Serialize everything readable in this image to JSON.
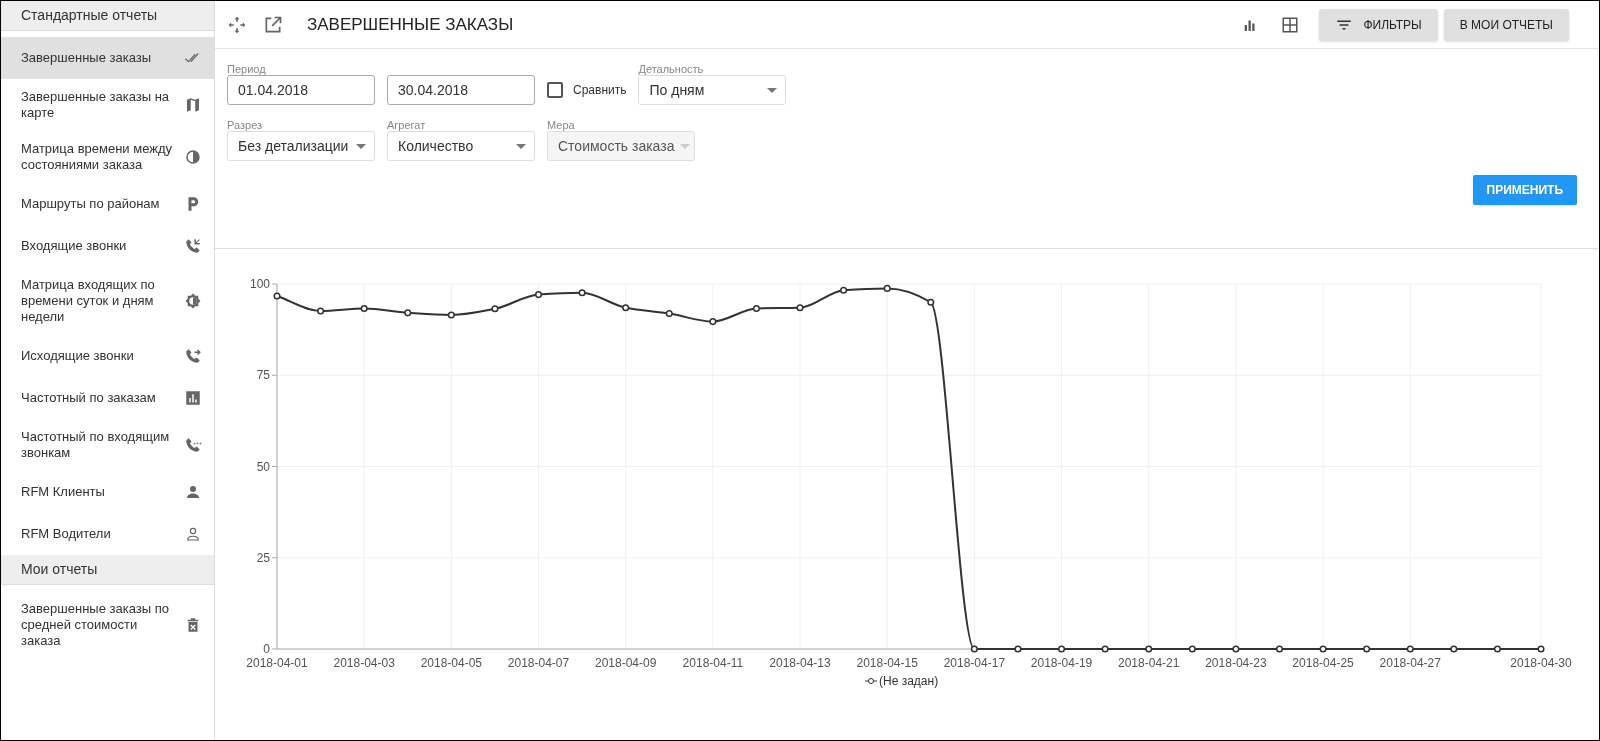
{
  "sidebar": {
    "sections": [
      {
        "title": "Стандартные отчеты",
        "items": [
          {
            "label": "Завершенные заказы",
            "selected": true
          },
          {
            "label": "Завершенные заказы на карте",
            "selected": false
          },
          {
            "label": "Матрица времени между состояниями заказа",
            "selected": false
          },
          {
            "label": "Маршруты по районам",
            "selected": false
          },
          {
            "label": "Входящие звонки",
            "selected": false
          },
          {
            "label": "Матрица входящих по времени суток и дням недели",
            "selected": false
          },
          {
            "label": "Исходящие звонки",
            "selected": false
          },
          {
            "label": "Частотный по заказам",
            "selected": false
          },
          {
            "label": "Частотный по входящим звонкам",
            "selected": false
          },
          {
            "label": "RFM Клиенты",
            "selected": false
          },
          {
            "label": "RFM Водители",
            "selected": false
          }
        ]
      },
      {
        "title": "Мои отчеты",
        "items": [
          {
            "label": "Завершенные заказы по средней стоимости заказа",
            "selected": false
          }
        ]
      }
    ]
  },
  "header": {
    "title": "ЗАВЕРШЕННЫЕ ЗАКАЗЫ",
    "buttons": [
      {
        "label": "ФИЛЬТРЫ"
      },
      {
        "label": "В МОИ ОТЧЕТЫ"
      }
    ]
  },
  "filters": {
    "period_label": "Период",
    "date_from": "01.04.2018",
    "date_to": "30.04.2018",
    "compare": {
      "label": "Сравнить",
      "checked": false
    },
    "selects": [
      {
        "label": "Детальность",
        "value": "По дням",
        "disabled": false
      },
      {
        "label": "Разрез",
        "value": "Без детализации",
        "disabled": false
      },
      {
        "label": "Агрегат",
        "value": "Количество",
        "disabled": false
      },
      {
        "label": "Мера",
        "value": "Стоимость заказа",
        "disabled": true
      }
    ],
    "apply_button": "ПРИМЕНИТЬ"
  },
  "chart": {
    "chart_data": {
      "type": "line",
      "x": [
        "2018-04-01",
        "2018-04-02",
        "2018-04-03",
        "2018-04-04",
        "2018-04-05",
        "2018-04-06",
        "2018-04-07",
        "2018-04-08",
        "2018-04-09",
        "2018-04-10",
        "2018-04-11",
        "2018-04-12",
        "2018-04-13",
        "2018-04-14",
        "2018-04-15",
        "2018-04-16",
        "2018-04-17",
        "2018-04-18",
        "2018-04-19",
        "2018-04-20",
        "2018-04-21",
        "2018-04-22",
        "2018-04-23",
        "2018-04-24",
        "2018-04-25",
        "2018-04-26",
        "2018-04-27",
        "2018-04-28",
        "2018-04-29",
        "2018-04-30"
      ],
      "series": [
        {
          "name": "(Не задан)",
          "color": "#333333",
          "marker": "circle",
          "values": [
            96.7,
            92.6,
            93.3,
            92.1,
            91.5,
            93.2,
            97.1,
            97.6,
            93.5,
            91.9,
            89.7,
            93.3,
            93.5,
            98.3,
            98.8,
            95,
            0,
            0,
            0,
            0,
            0,
            0,
            0,
            0,
            0,
            0,
            0,
            0,
            0,
            0
          ]
        }
      ],
      "xlim": [
        "2018-04-01",
        "2018-04-30"
      ],
      "ylim": [
        0,
        100
      ],
      "grid": true,
      "yticks": [
        0,
        25,
        50,
        75,
        100
      ],
      "xticks": [
        "2018-04-01",
        "2018-04-03",
        "2018-04-05",
        "2018-04-07",
        "2018-04-09",
        "2018-04-11",
        "2018-04-13",
        "2018-04-15",
        "2018-04-17",
        "2018-04-19",
        "2018-04-21",
        "2018-04-23",
        "2018-04-25",
        "2018-04-27",
        "2018-04-30"
      ]
    }
  }
}
